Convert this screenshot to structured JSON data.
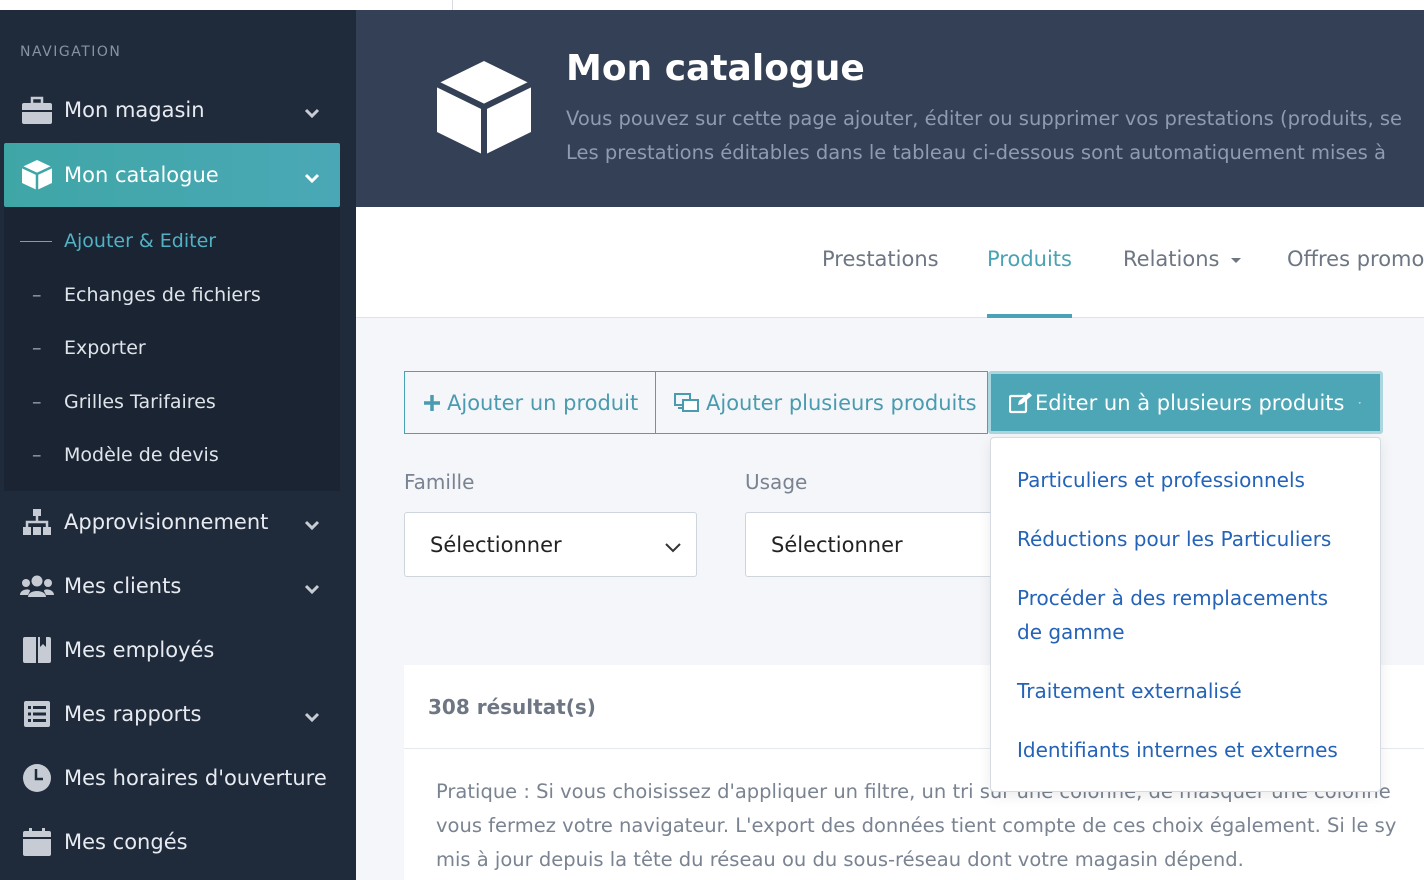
{
  "sidebar": {
    "heading": "NAVIGATION",
    "items": [
      {
        "label": "Mon magasin",
        "icon": "briefcase-icon"
      },
      {
        "label": "Mon catalogue",
        "icon": "cube-icon"
      },
      {
        "label": "Approvisionnement",
        "icon": "sitemap-icon"
      },
      {
        "label": "Mes clients",
        "icon": "users-icon"
      },
      {
        "label": "Mes employés",
        "icon": "book-icon"
      },
      {
        "label": "Mes rapports",
        "icon": "list-icon"
      },
      {
        "label": "Mes horaires d'ouverture",
        "icon": "clock-icon"
      },
      {
        "label": "Mes congés",
        "icon": "calendar-icon"
      }
    ],
    "submenu": [
      {
        "label": "Ajouter & Editer"
      },
      {
        "label": "Echanges de fichiers"
      },
      {
        "label": "Exporter"
      },
      {
        "label": "Grilles Tarifaires"
      },
      {
        "label": "Modèle de devis"
      }
    ],
    "dash": "–"
  },
  "banner": {
    "title": "Mon catalogue",
    "desc_line1": "Vous pouvez sur cette page ajouter, éditer ou supprimer vos prestations (produits, se",
    "desc_line2": "Les prestations éditables dans le tableau ci-dessous sont automatiquement mises à"
  },
  "tabs": [
    {
      "label": "Prestations"
    },
    {
      "label": "Produits"
    },
    {
      "label": "Relations"
    },
    {
      "label": "Offres promot"
    }
  ],
  "buttons": {
    "add_one": "Ajouter un produit",
    "add_many": "Ajouter plusieurs produits",
    "edit": "Editer un à plusieurs produits"
  },
  "filters": {
    "famille_label": "Famille",
    "usage_label": "Usage",
    "famille_value": "Sélectionner",
    "usage_value": "Sélectionner"
  },
  "results": {
    "count": "308 résultat(s)",
    "line1": "Pratique : Si vous choisissez d'appliquer un filtre, un tri sur une colonne, de masquer une colonne",
    "line2": "vous fermez votre navigateur. L'export des données tient compte de ces choix également.  Si le sy",
    "line3": "mis à jour depuis la tête du réseau ou du sous-réseau dont votre magasin dépend."
  },
  "dropdown": {
    "items": [
      "Particuliers et professionnels",
      "Réductions pour les Particuliers",
      "Procéder à des remplacements",
      "de gamme",
      "Traitement externalisé",
      "Identifiants internes et externes"
    ]
  },
  "colors": {
    "accent": "#4aa3b4",
    "sidebar": "#1f2a3a",
    "banner": "#344055",
    "link": "#2463b8"
  }
}
